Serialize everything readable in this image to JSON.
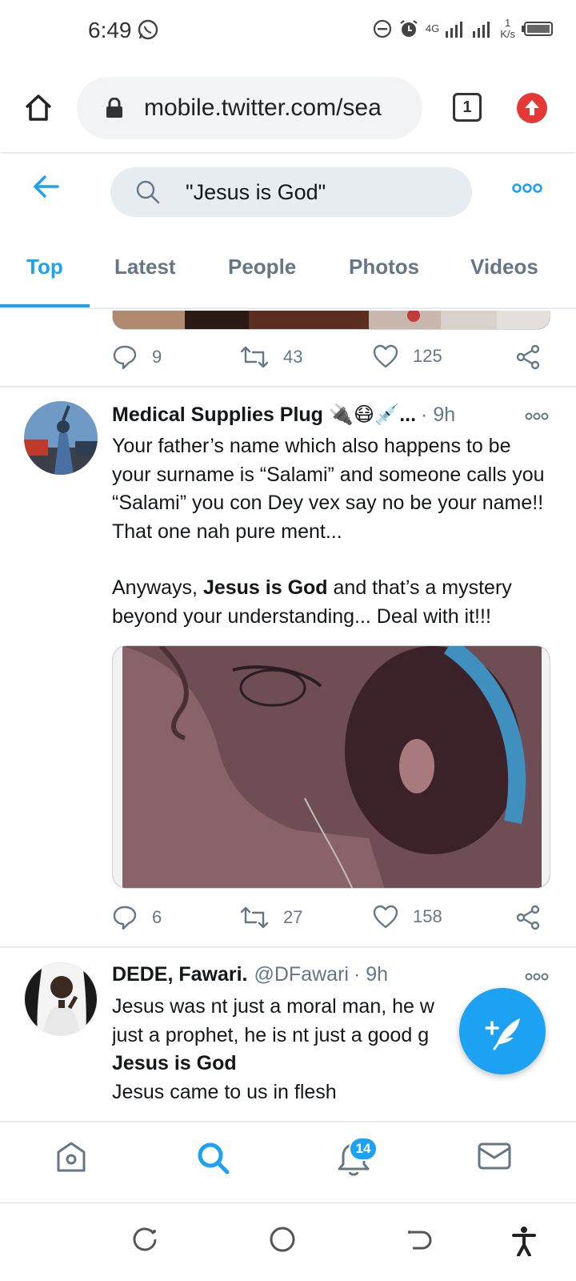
{
  "status_bar": {
    "time": "6:49",
    "network": "4G",
    "speed_value": "1",
    "speed_unit": "K/s"
  },
  "browser": {
    "url": "mobile.twitter.com/sea",
    "tab_count": "1"
  },
  "search": {
    "query": "\"Jesus is God\""
  },
  "tabs": [
    {
      "label": "Top",
      "active": true
    },
    {
      "label": "Latest",
      "active": false
    },
    {
      "label": "People",
      "active": false
    },
    {
      "label": "Photos",
      "active": false
    },
    {
      "label": "Videos",
      "active": false
    }
  ],
  "tweets": [
    {
      "replies": "9",
      "retweets": "43",
      "likes": "125"
    },
    {
      "name": "Medical Supplies Plug 🔌😷💉...",
      "time": "· 9h",
      "text_1": "Your father’s name which also happens to be your surname is “Salami” and someone calls you “Salami” you con Dey vex say no be your name!! That one nah pure ment...",
      "text_2a": "Anyways, ",
      "text_2b": "Jesus is God",
      "text_2c": " and that’s a mystery beyond your understanding... Deal with it!!!",
      "replies": "6",
      "retweets": "27",
      "likes": "158"
    },
    {
      "name": "DEDE, Fawari.",
      "handle": "@DFawari",
      "time": "· 9h",
      "text_1": "Jesus was nt just a moral man, he w",
      "text_2": "just a prophet, he is nt just a good g",
      "text_3": "Jesus is God",
      "text_4": "Jesus came to us in flesh"
    }
  ],
  "bottom_nav": {
    "notifications_badge": "14"
  },
  "colors": {
    "accent": "#1da1f2",
    "muted": "#657786"
  }
}
